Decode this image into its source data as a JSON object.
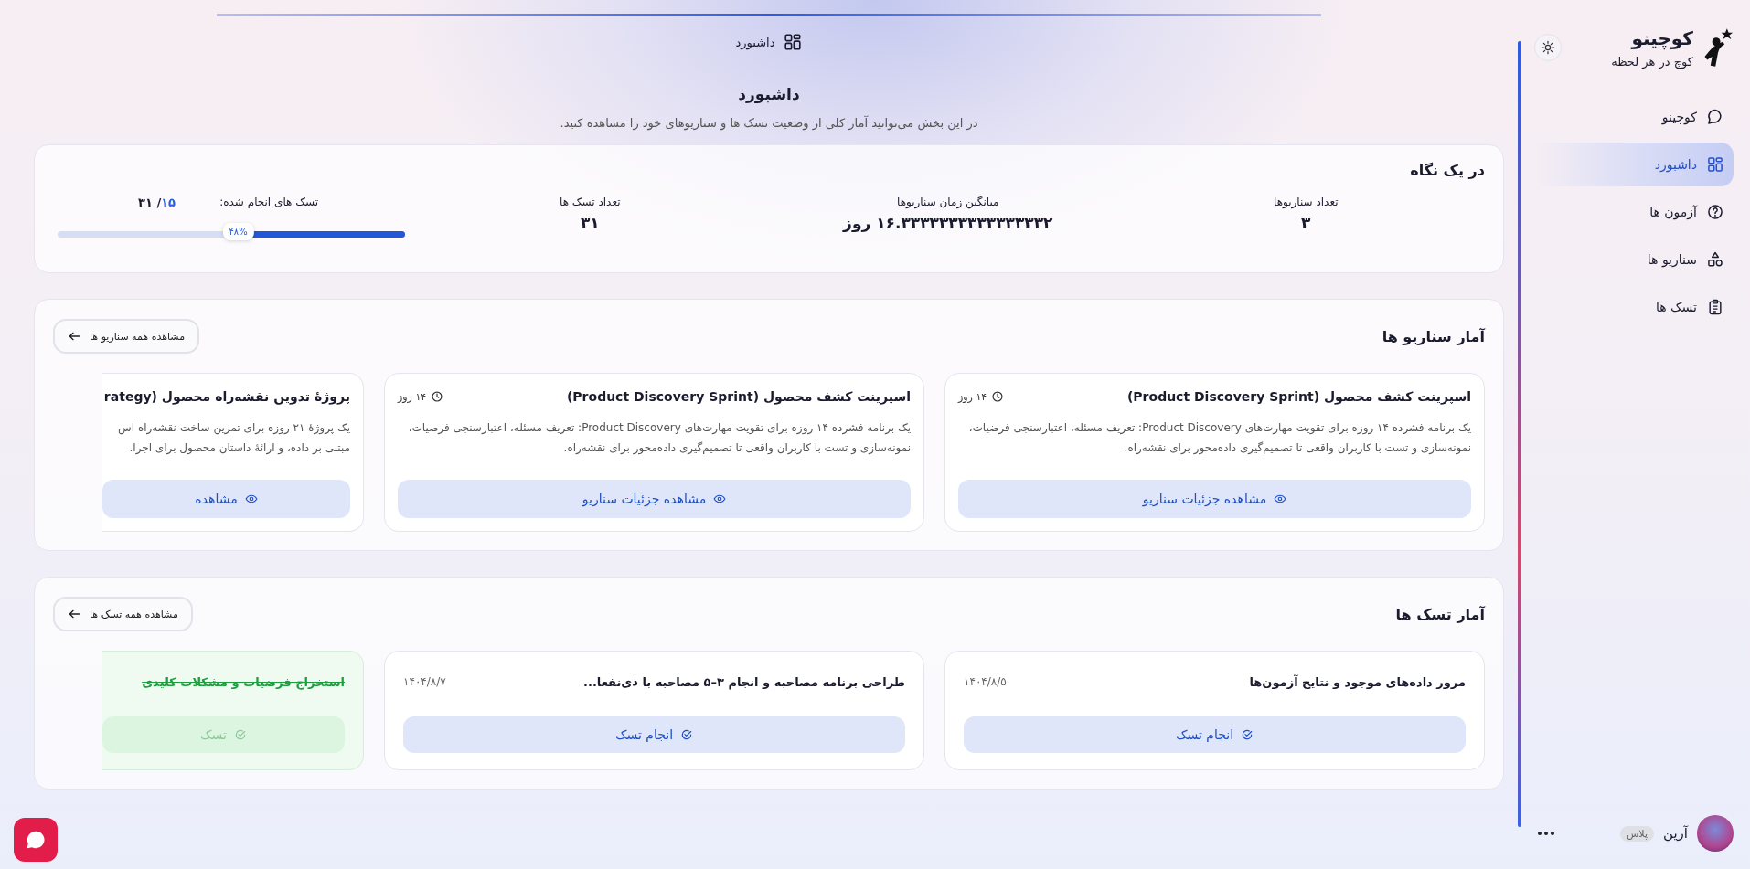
{
  "sidebar": {
    "brand": {
      "title": "کوچینو",
      "tagline": "کوچ در هر لحظه"
    },
    "nav": [
      {
        "label": "کوچینو",
        "selected": false
      },
      {
        "label": "داشبورد",
        "selected": true
      },
      {
        "label": "آزمون ها",
        "selected": false
      },
      {
        "label": "سناریو ها",
        "selected": false
      },
      {
        "label": "تسک ها",
        "selected": false
      }
    ],
    "user": {
      "name": "آرین",
      "badge": "پلاس"
    }
  },
  "breadcrumb": "داشبورد",
  "page": {
    "title": "داشبورد",
    "subtitle": "در این بخش می‌توانید آمار کلی از وضعیت تسک ها و سناریوهای خود را مشاهده کنید."
  },
  "overview": {
    "title": "در یک نگاه",
    "stats": [
      {
        "label": "تعداد سناریوها",
        "value": "۳"
      },
      {
        "label": "میانگین زمان سناریوها",
        "value": "۱۶.۳۳۳۳۳۳۳۳۳۳۳۳۳۳۳۲ روز"
      },
      {
        "label": "تعداد تسک ها",
        "value": "۳۱"
      }
    ],
    "progress": {
      "label": "تسک های انجام شده:",
      "done": "۱۵",
      "total": "/ ۳۱",
      "level": 0.48,
      "percent": "۴۸%"
    }
  },
  "scenarios": {
    "title": "آمار سناریو ها",
    "all_button": "مشاهده همه سناریو ها",
    "items": [
      {
        "title": "اسپرینت کشف محصول (Product Discovery Sprint)",
        "duration": "۱۴ روز",
        "description": "یک برنامه فشرده ۱۴ روزه برای تقویت مهارت‌های Product Discovery: تعریف مسئله، اعتبارسنجی فرضیات، نمونه‌سازی و تست با کاربران واقعی تا تصمیم‌گیری داده‌محور برای نقشه‌راه.",
        "action": "مشاهده جزئیات سناریو"
      },
      {
        "title": "اسپرینت کشف محصول (Product Discovery Sprint)",
        "duration": "۱۴ روز",
        "description": "یک برنامه فشرده ۱۴ روزه برای تقویت مهارت‌های Product Discovery: تعریف مسئله، اعتبارسنجی فرضیات، نمونه‌سازی و تست با کاربران واقعی تا تصمیم‌گیری داده‌محور برای نقشه‌راه.",
        "action": "مشاهده جزئیات سناریو"
      },
      {
        "title": "پروژهٔ تدوین نقشه‌راه محصول (rategy",
        "description": "یک پروژهٔ ۲۱ روزه برای تمرین ساخت نقشه‌راه اس\nمبتنی بر داده، و ارائهٔ داستان محصول برای اجرا.",
        "action": "مشاهده"
      }
    ]
  },
  "tasks": {
    "title": "آمار تسک ها",
    "all_button": "مشاهده همه تسک ها",
    "items": [
      {
        "title": "مرور داده‌های موجود و نتایج آزمون‌ها",
        "date": "۱۴۰۴/۸/۵",
        "action": "انجام تسک",
        "done": false
      },
      {
        "title": "طراحی برنامه مصاحبه و انجام ۳–۵ مصاحبه با ذی‌نفعا...",
        "date": "۱۴۰۴/۸/۷",
        "action": "انجام تسک",
        "done": false
      },
      {
        "title": "استخراج فرضیات و مشکلات کلیدی",
        "action": "تسک",
        "done": true
      }
    ]
  }
}
